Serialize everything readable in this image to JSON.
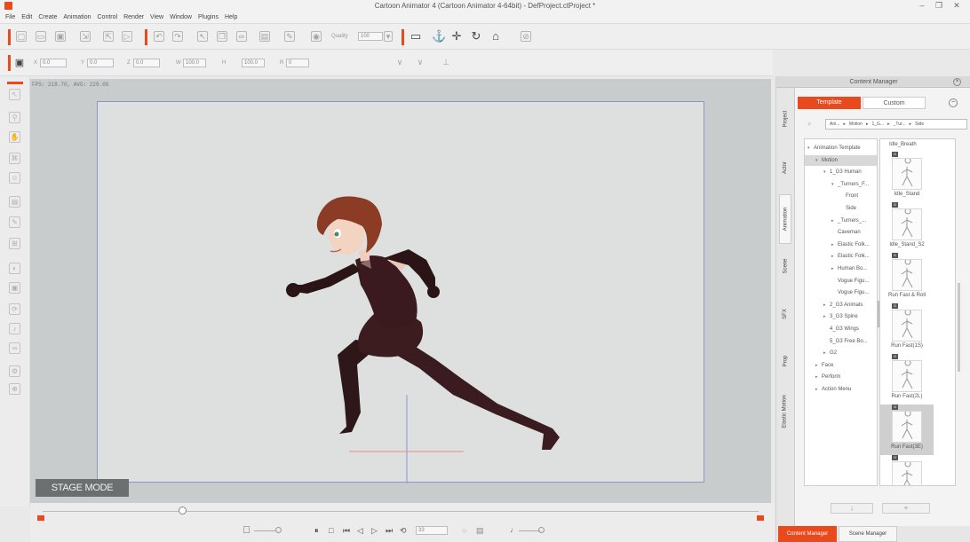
{
  "window": {
    "title": "Cartoon Animator 4  (Cartoon Animator 4-64bit) - DefProject.ctProject *",
    "minimize": "–",
    "restore": "❐",
    "close": "✕"
  },
  "menu": [
    "File",
    "Edit",
    "Create",
    "Animation",
    "Control",
    "Render",
    "View",
    "Window",
    "Plugins",
    "Help"
  ],
  "toolbar": {
    "quality_label": "Quality",
    "quality_value": "100"
  },
  "transform_bar": {
    "fields": [
      {
        "label": "X",
        "value": "0.0"
      },
      {
        "label": "Y",
        "value": "0.0"
      },
      {
        "label": "Z",
        "value": "0.0"
      },
      {
        "label": "W",
        "value": "100.0"
      },
      {
        "label": "H",
        "value": "100.0"
      },
      {
        "label": "R",
        "value": "0"
      }
    ]
  },
  "stage": {
    "fps": "FPS: 218.70, AVG: 228.05",
    "mode_label": "STAGE MODE"
  },
  "timeline": {
    "frame": "33"
  },
  "content_manager": {
    "title": "Content Manager",
    "tabs": [
      "Template",
      "Custom"
    ],
    "active_tab": "Template",
    "breadcrumb": [
      "Ani...",
      "Motion",
      "1_G...",
      "_Tur...",
      "Side"
    ],
    "side_tabs": [
      "Project",
      "Actor",
      "Animation",
      "Scene",
      "SFX",
      "Prop",
      "Elastic Motion"
    ],
    "active_side_tab": "Animation",
    "tree": [
      {
        "label": "Animation Template",
        "indent": 0,
        "arrow": "▾"
      },
      {
        "label": "Motion",
        "indent": 1,
        "arrow": "▾",
        "selected": true
      },
      {
        "label": "1_G3 Human",
        "indent": 2,
        "arrow": "▾"
      },
      {
        "label": "_Turners_F...",
        "indent": 3,
        "arrow": "▾"
      },
      {
        "label": "Front",
        "indent": 4,
        "arrow": ""
      },
      {
        "label": "Side",
        "indent": 4,
        "arrow": ""
      },
      {
        "label": "_Turners_...",
        "indent": 3,
        "arrow": "▸"
      },
      {
        "label": "Caveman",
        "indent": 3,
        "arrow": ""
      },
      {
        "label": "Elastic Folk...",
        "indent": 3,
        "arrow": "▸"
      },
      {
        "label": "Elastic Folk...",
        "indent": 3,
        "arrow": "▸"
      },
      {
        "label": "Human Bo...",
        "indent": 3,
        "arrow": "▸"
      },
      {
        "label": "Vogue Figu...",
        "indent": 3,
        "arrow": ""
      },
      {
        "label": "Vogue Figu...",
        "indent": 3,
        "arrow": ""
      },
      {
        "label": "2_G3 Animals",
        "indent": 2,
        "arrow": "▸"
      },
      {
        "label": "3_G3 Spine",
        "indent": 2,
        "arrow": "▸"
      },
      {
        "label": "4_G3 Wings",
        "indent": 2,
        "arrow": ""
      },
      {
        "label": "5_G3 Free Bo...",
        "indent": 2,
        "arrow": ""
      },
      {
        "label": "G2",
        "indent": 2,
        "arrow": "▸"
      },
      {
        "label": "Face",
        "indent": 1,
        "arrow": "▸"
      },
      {
        "label": "Perform",
        "indent": 1,
        "arrow": "▸"
      },
      {
        "label": "Action Menu",
        "indent": 1,
        "arrow": "▸"
      }
    ],
    "first_label": "Idle_Breath",
    "thumbnails": [
      {
        "label": "Idle_Stand",
        "badge": "G"
      },
      {
        "label": "Idle_Stand_S2",
        "badge": "G"
      },
      {
        "label": "Run Fast & Roll",
        "badge": "G"
      },
      {
        "label": "Run Fast(1S)",
        "badge": "G"
      },
      {
        "label": "Run Fast(2L)",
        "badge": "G"
      },
      {
        "label": "Run Fast(3E)",
        "badge": "G",
        "selected": true
      },
      {
        "label": "",
        "badge": "G"
      }
    ],
    "bottom_tabs": [
      "Content Manager",
      "Scene Manager"
    ]
  },
  "colors": {
    "accent": "#e8491d",
    "stage_bg": "#dde0df",
    "stage_border": "#8899c4"
  }
}
